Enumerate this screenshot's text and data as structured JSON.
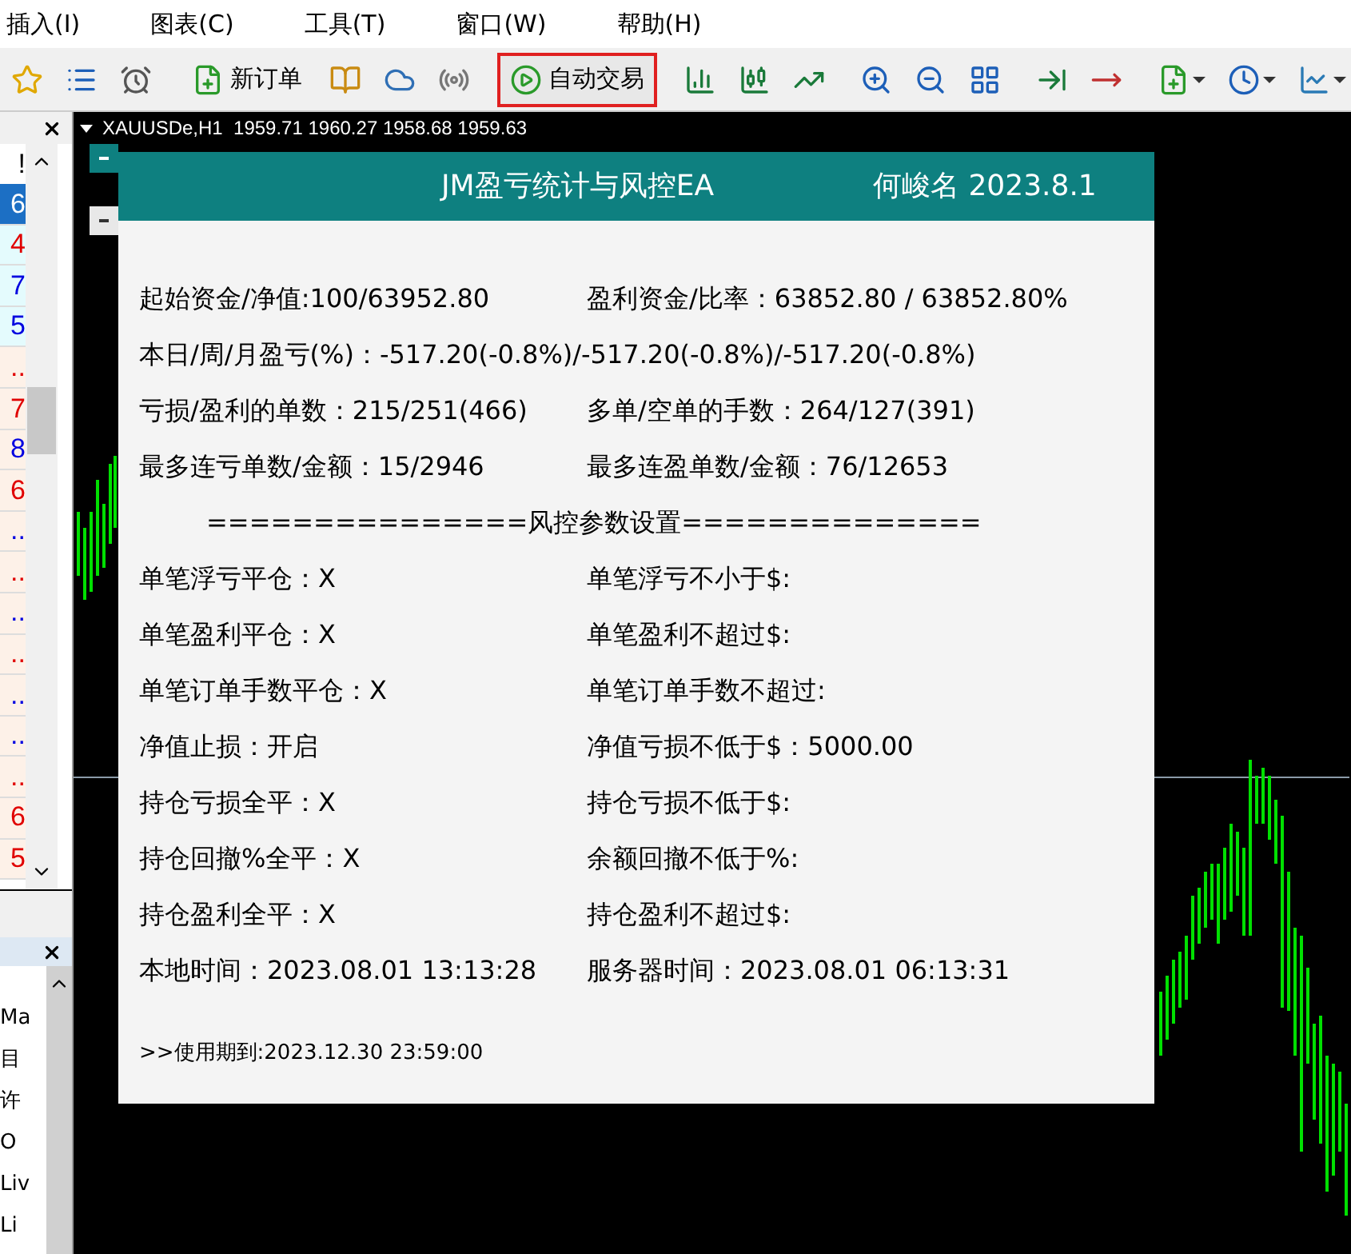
{
  "menu": [
    "插入(I)",
    "图表(C)",
    "工具(T)",
    "窗口(W)",
    "帮助(H)"
  ],
  "toolbar": [
    {
      "kind": "icon"
    },
    {
      "kind": "icon"
    },
    {
      "kind": "icon"
    },
    {
      "kind": "sep"
    },
    {
      "kind": "button",
      "label": "新订单",
      "highlighted": false
    },
    {
      "kind": "icon"
    },
    {
      "kind": "icon"
    },
    {
      "kind": "icon"
    },
    {
      "kind": "sep"
    },
    {
      "kind": "button",
      "label": "自动交易",
      "highlighted": true
    },
    {
      "kind": "sep"
    },
    {
      "kind": "icon"
    },
    {
      "kind": "icon"
    },
    {
      "kind": "icon"
    },
    {
      "kind": "sep"
    },
    {
      "kind": "icon"
    },
    {
      "kind": "icon"
    },
    {
      "kind": "icon"
    },
    {
      "kind": "sep"
    },
    {
      "kind": "icon"
    },
    {
      "kind": "icon"
    },
    {
      "kind": "sep"
    },
    {
      "kind": "icon",
      "dropdown": true
    },
    {
      "kind": "icon",
      "dropdown": true
    },
    {
      "kind": "icon",
      "dropdown": true
    }
  ],
  "left_panel": {
    "header": "!",
    "rows": [
      {
        "text": "6",
        "selected": true
      },
      {
        "text": "4",
        "color": "#e00000",
        "selected": false
      },
      {
        "text": "7",
        "color": "#0000e0",
        "selected": false
      },
      {
        "text": "5",
        "color": "#0000e0",
        "selected": false
      },
      {
        "text": "..",
        "color": "#e00000",
        "selected": false
      },
      {
        "text": "7",
        "color": "#e00000",
        "selected": false
      },
      {
        "text": "8",
        "color": "#0000e0",
        "selected": false
      },
      {
        "text": "6",
        "color": "#e00000",
        "selected": false
      },
      {
        "text": "..",
        "color": "#0000e0",
        "selected": false
      },
      {
        "text": "..",
        "color": "#e00000",
        "selected": false
      },
      {
        "text": "..",
        "color": "#0000e0",
        "selected": false
      },
      {
        "text": "..",
        "color": "#e00000",
        "selected": false
      },
      {
        "text": "..",
        "color": "#0000e0",
        "selected": false
      },
      {
        "text": "..",
        "color": "#0000e0",
        "selected": false
      },
      {
        "text": "..",
        "color": "#e00000",
        "selected": false
      },
      {
        "text": "6",
        "color": "#e00000",
        "selected": false
      },
      {
        "text": "5",
        "color": "#e00000",
        "selected": false
      }
    ]
  },
  "navigator": {
    "items": [
      "Ma",
      "目",
      "许",
      "O",
      "Liv",
      "Li"
    ]
  },
  "chart": {
    "header": "XAUUSDe,H1  1959.71 1960.27 1958.68 1959.63"
  },
  "ea_panel": {
    "title": "JM盈亏统计与风控EA",
    "author": "何峻名 2023.8.1",
    "stats": [
      [
        "起始资金/净值:100/63952.80",
        "盈利资金/比率：63852.80 / 63852.80%"
      ],
      [
        "本日/周/月盈亏(%)：-517.20(-0.8%)/-517.20(-0.8%)/-517.20(-0.8%)"
      ],
      [
        "亏损/盈利的单数：215/251(466)",
        "多单/空单的手数：264/127(391)"
      ],
      [
        "最多连亏单数/金额：15/2946",
        "最多连盈单数/金额：76/12653"
      ]
    ],
    "separator": "===============风控参数设置==============",
    "settings": [
      [
        "单笔浮亏平仓：X",
        "单笔浮亏不小于$:"
      ],
      [
        "单笔盈利平仓：X",
        "单笔盈利不超过$:"
      ],
      [
        "单笔订单手数平仓：X",
        "单笔订单手数不超过:"
      ],
      [
        "净值止损：开启",
        "净值亏损不低于$：5000.00"
      ],
      [
        "持仓亏损全平：X",
        "持仓亏损不低于$:"
      ],
      [
        "持仓回撤%全平：X",
        "余额回撤不低于%:"
      ],
      [
        "持仓盈利全平：X",
        "持仓盈利不超过$:"
      ],
      [
        "本地时间：2023.08.01 13:13:28",
        "服务器时间：2023.08.01 06:13:31"
      ]
    ],
    "footer": ">>使用期到:2023.12.30 23:59:00"
  }
}
